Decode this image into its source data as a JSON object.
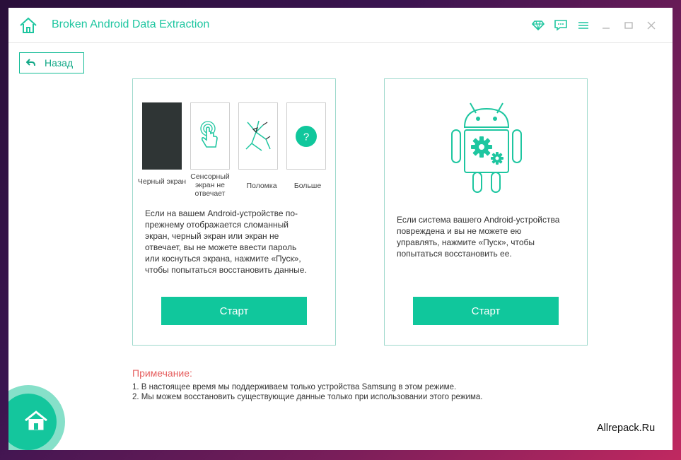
{
  "window": {
    "title": "Broken Android Data Extraction"
  },
  "toolbar": {
    "icons": [
      "diamond-icon",
      "feedback-icon",
      "menu-icon",
      "minimize-icon",
      "maximize-icon",
      "close-icon"
    ]
  },
  "back_button": {
    "label": "Назад"
  },
  "left_card": {
    "thumbnails": [
      {
        "label": "Черный экран",
        "icon": "black-screen-icon"
      },
      {
        "label": "Сенсорный экран не отвечает",
        "icon": "touch-icon"
      },
      {
        "label": "Поломка",
        "icon": "broken-screen-icon"
      },
      {
        "label": "Больше",
        "icon": "question-icon"
      }
    ],
    "description": "Если на вашем Android-устройстве по-прежнему отображается сломанный экран, черный экран или экран не отвечает, вы не можете ввести пароль или коснуться экрана, нажмите «Пуск», чтобы попытаться восстановить данные.",
    "description_lines": [
      "Если на вашем Android-устройстве по-",
      "прежнему отображается сломанный",
      "экран, черный экран или экран не",
      "отвечает, вы не можете ввести пароль",
      "или коснуться экрана, нажмите «Пуск»,",
      "чтобы попытаться восстановить данные."
    ],
    "start_label": "Старт"
  },
  "right_card": {
    "icon": "android-settings-icon",
    "description_lines": [
      "Если система вашего Android-устройства",
      "повреждена и вы не можете ею",
      "управлять, нажмите «Пуск», чтобы",
      "попытаться восстановить ее."
    ],
    "start_label": "Старт"
  },
  "notes": {
    "title": "Примечание:",
    "lines": [
      "1. В настоящее время мы поддерживаем только устройства Samsung в этом режиме.",
      "2. Мы можем восстановить существующие данные только при использовании этого режима."
    ]
  },
  "watermark": "Allrepack.Ru",
  "colors": {
    "accent": "#10c79c",
    "title": "#1ec6a0",
    "note": "#e55e5e",
    "card_border": "#9ed9cc"
  }
}
